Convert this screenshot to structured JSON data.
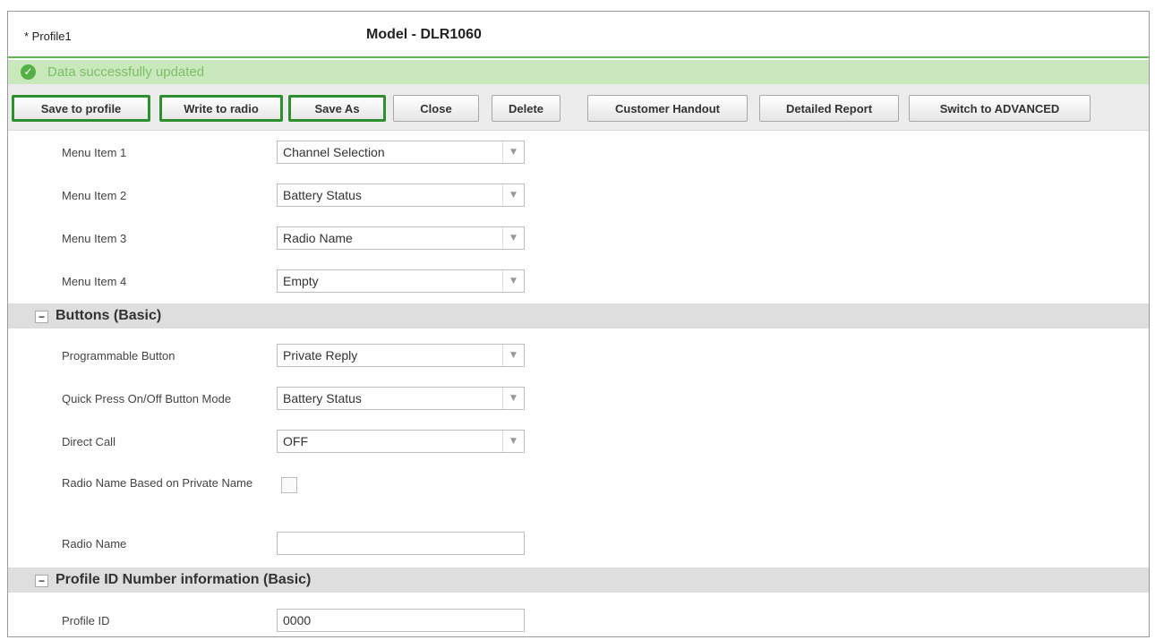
{
  "header": {
    "profile_name": "* Profile1",
    "model_title": "Model - DLR1060"
  },
  "status": {
    "icon": "check-circle-icon",
    "message": "Data successfully updated",
    "color": "#c9e9bd"
  },
  "toolbar": {
    "save_to_profile": "Save to profile",
    "write_to_radio": "Write to radio",
    "save_as": "Save As",
    "close": "Close",
    "delete": "Delete",
    "customer_handout": "Customer Handout",
    "detailed_report": "Detailed Report",
    "switch_advanced": "Switch to ADVANCED",
    "highlight_color": "#2e8f2e"
  },
  "menu_items": [
    {
      "label": "Menu Item 1",
      "value": "Channel Selection"
    },
    {
      "label": "Menu Item 2",
      "value": "Battery Status"
    },
    {
      "label": "Menu Item 3",
      "value": "Radio Name"
    },
    {
      "label": "Menu Item 4",
      "value": "Empty"
    }
  ],
  "buttons_section": {
    "title": "Buttons (Basic)",
    "collapse_symbol": "−",
    "programmable_button": {
      "label": "Programmable Button",
      "value": "Private Reply"
    },
    "quick_press": {
      "label": "Quick Press On/Off Button Mode",
      "value": "Battery Status"
    },
    "direct_call": {
      "label": "Direct Call",
      "value": "OFF"
    },
    "radio_name_private": {
      "label": "Radio Name Based on Private Name",
      "checked": false
    },
    "radio_name": {
      "label": "Radio Name",
      "value": ""
    }
  },
  "profile_id_section": {
    "title": "Profile ID Number information (Basic)",
    "collapse_symbol": "−",
    "profile_id": {
      "label": "Profile ID",
      "value": "0000"
    }
  }
}
